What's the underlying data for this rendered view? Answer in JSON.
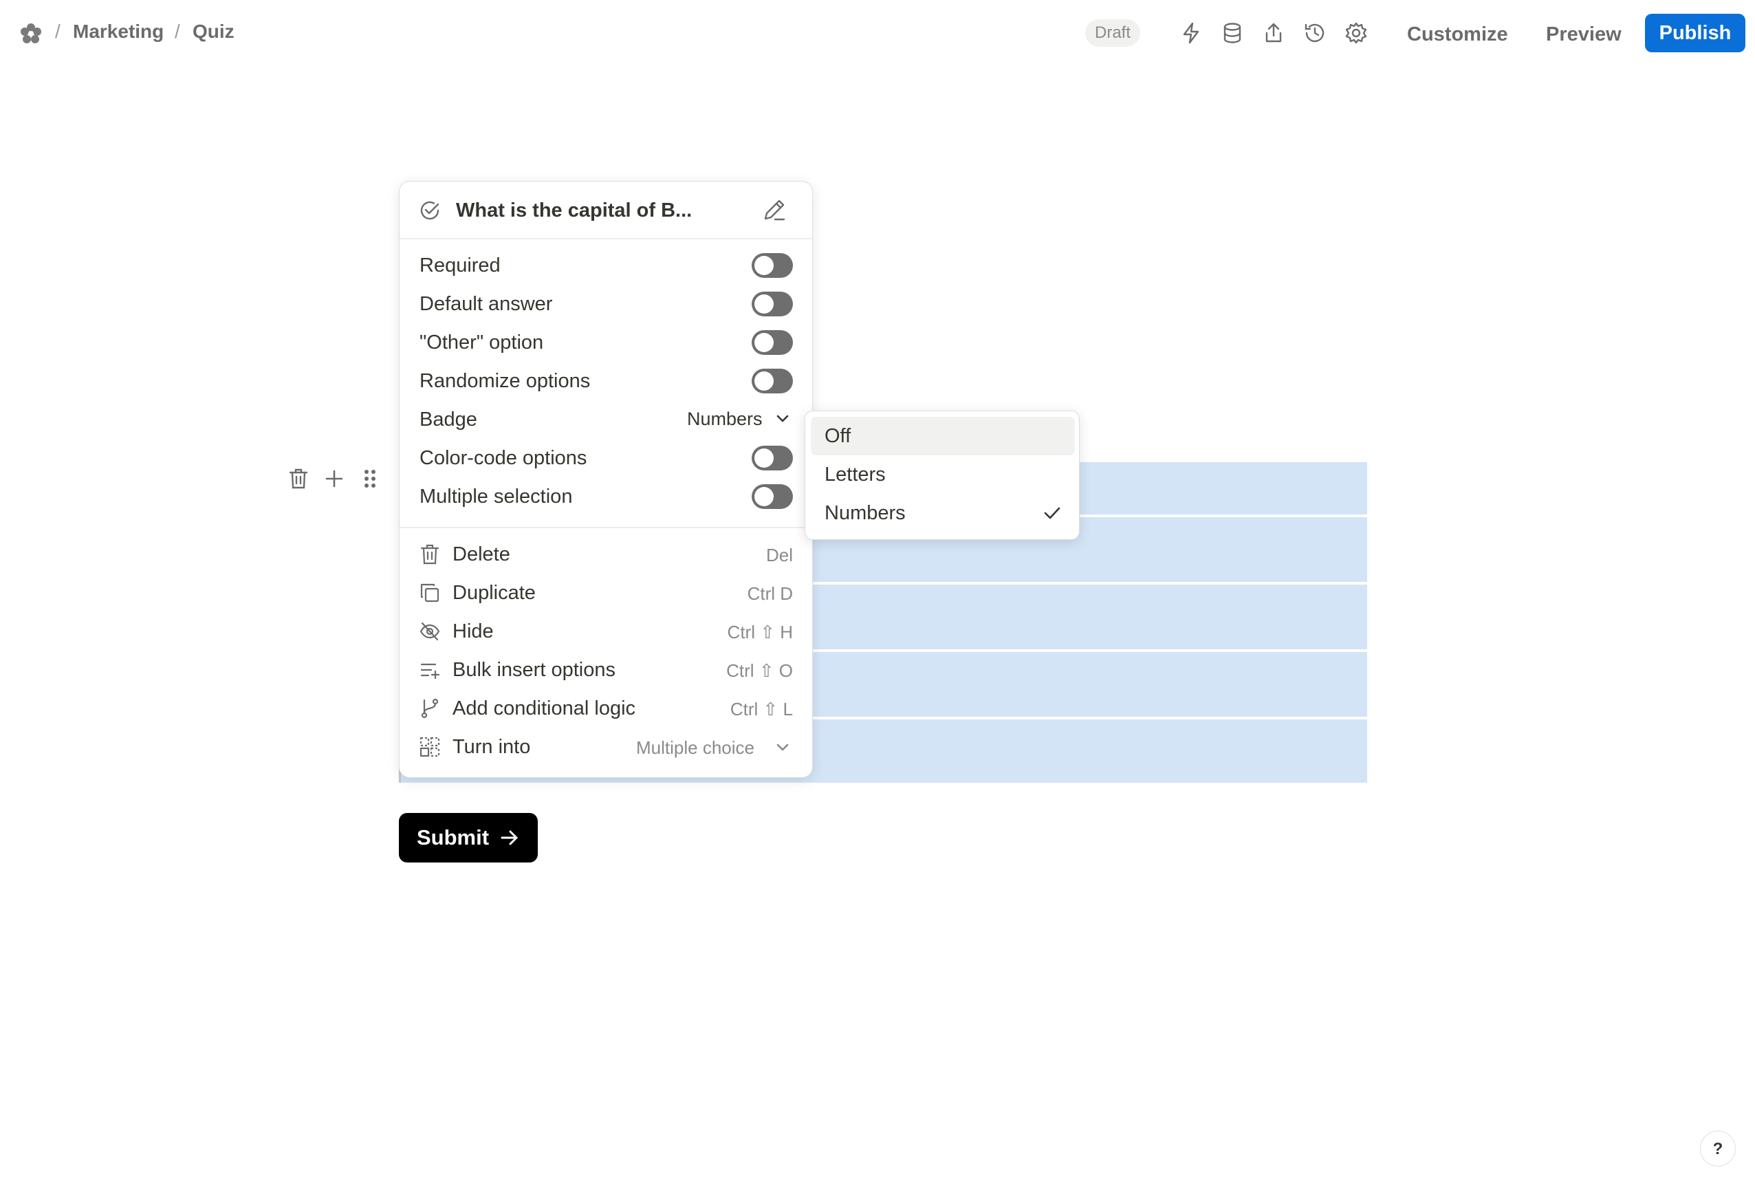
{
  "breadcrumb": {
    "items": [
      "Marketing",
      "Quiz"
    ],
    "separator": "/"
  },
  "status": "Draft",
  "toolbar": {
    "customize": "Customize",
    "preview": "Preview",
    "publish": "Publish"
  },
  "colors": {
    "primary": "#0a6fd8",
    "selection": "#d2e4f6",
    "toggle_off": "#6e6e6e"
  },
  "question_menu": {
    "title": "What is the capital of B...",
    "settings": [
      {
        "label": "Required",
        "toggle": false
      },
      {
        "label": "Default answer",
        "toggle": false
      },
      {
        "label": "\"Other\" option",
        "toggle": false
      },
      {
        "label": "Randomize options",
        "toggle": false
      },
      {
        "label": "Badge",
        "value": "Numbers"
      },
      {
        "label": "Color-code options",
        "toggle": false
      },
      {
        "label": "Multiple selection",
        "toggle": false
      }
    ],
    "actions": [
      {
        "label": "Delete",
        "shortcut": "Del",
        "icon": "trash-icon"
      },
      {
        "label": "Duplicate",
        "shortcut": "Ctrl D",
        "icon": "duplicate-icon"
      },
      {
        "label": "Hide",
        "shortcut": "Ctrl ⇧ H",
        "icon": "eye-off-icon"
      },
      {
        "label": "Bulk insert options",
        "shortcut": "Ctrl ⇧ O",
        "icon": "list-add-icon"
      },
      {
        "label": "Add conditional logic",
        "shortcut": "Ctrl ⇧ L",
        "icon": "branch-icon"
      },
      {
        "label": "Turn into",
        "value": "Multiple choice",
        "icon": "transform-icon"
      }
    ]
  },
  "badge_dropdown": {
    "options": [
      "Off",
      "Letters",
      "Numbers"
    ],
    "highlighted": "Off",
    "selected": "Numbers"
  },
  "submit": {
    "label": "Submit"
  },
  "help": {
    "label": "?"
  }
}
